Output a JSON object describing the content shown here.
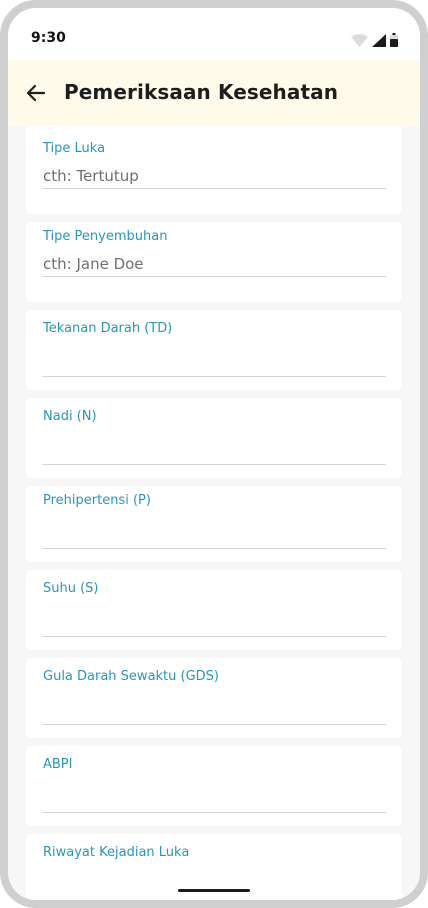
{
  "status_bar": {
    "time": "9:30",
    "icons": [
      "wifi-icon",
      "signal-icon",
      "battery-icon"
    ]
  },
  "app_bar": {
    "back_icon": "arrow-left-icon",
    "title": "Pemeriksaan Kesehatan"
  },
  "form": {
    "fields": [
      {
        "label": "Tipe Luka",
        "placeholder": "cth: Tertutup"
      },
      {
        "label": "Tipe Penyembuhan",
        "placeholder": "cth: Jane Doe"
      },
      {
        "label": "Tekanan Darah (TD)",
        "placeholder": ""
      },
      {
        "label": "Nadi (N)",
        "placeholder": ""
      },
      {
        "label": "Prehipertensi (P)",
        "placeholder": ""
      },
      {
        "label": "Suhu (S)",
        "placeholder": ""
      },
      {
        "label": "Gula Darah Sewaktu (GDS)",
        "placeholder": ""
      },
      {
        "label": "ABPI",
        "placeholder": ""
      },
      {
        "label": "Riwayat Kejadian Luka",
        "placeholder": ""
      }
    ]
  },
  "colors": {
    "accent": "#2a95b8",
    "app_bar_bg": "#fefbea",
    "page_bg": "#f7f7f7"
  }
}
